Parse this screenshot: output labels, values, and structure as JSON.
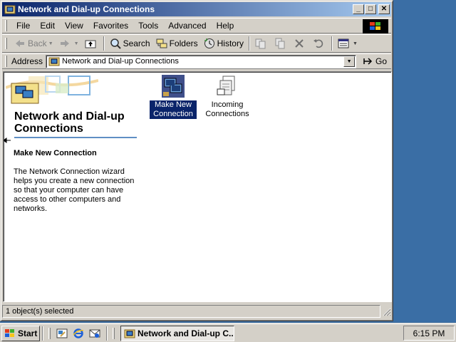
{
  "window": {
    "title": "Network and Dial-up Connections",
    "minimize_glyph": "_",
    "maximize_glyph": "□",
    "close_glyph": "✕"
  },
  "menu": [
    {
      "label": "File"
    },
    {
      "label": "Edit"
    },
    {
      "label": "View"
    },
    {
      "label": "Favorites"
    },
    {
      "label": "Tools"
    },
    {
      "label": "Advanced"
    },
    {
      "label": "Help"
    }
  ],
  "toolbar": {
    "back_label": "Back",
    "search_label": "Search",
    "folders_label": "Folders",
    "history_label": "History"
  },
  "address": {
    "label": "Address",
    "value": "Network and Dial-up Connections",
    "go_label": "Go"
  },
  "panel": {
    "title": "Network and Dial-up Connections",
    "subtitle": "Make New Connection",
    "description": "The Network Connection wizard helps you create a new connection so that your computer can have access to other computers and networks."
  },
  "items": [
    {
      "label": "Make New Connection",
      "icon": "make-new-connection-icon",
      "selected": true
    },
    {
      "label": "Incoming Connections",
      "icon": "incoming-connections-icon",
      "selected": false
    }
  ],
  "status": {
    "text": "1 object(s) selected"
  },
  "taskbar": {
    "start_label": "Start",
    "task_label": "Network and Dial-up C...",
    "clock": "6:15 PM"
  },
  "colors": {
    "desktop": "#3a6ea5",
    "title_start": "#0a246a",
    "title_end": "#a6caf0",
    "selection": "#0a246a"
  }
}
